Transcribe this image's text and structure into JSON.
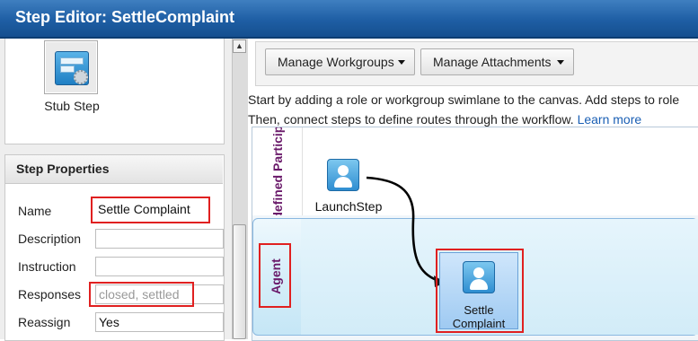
{
  "title": "Step Editor: SettleComplaint",
  "palette": {
    "stub_step_label": "Stub Step",
    "stub_icon": "stub-step-icon"
  },
  "properties": {
    "header": "Step Properties",
    "fields": {
      "name": {
        "label": "Name",
        "value": "Settle Complaint"
      },
      "description": {
        "label": "Description",
        "value": ""
      },
      "instruction": {
        "label": "Instruction",
        "value": ""
      },
      "responses": {
        "label": "Responses",
        "value": "",
        "placeholder": "closed, settled"
      },
      "reassign": {
        "label": "Reassign",
        "value": "Yes"
      }
    }
  },
  "toolbar": {
    "manage_workgroups": "Manage Workgroups",
    "manage_attachments": "Manage Attachments"
  },
  "intro": {
    "line1": "Start by adding a role or workgroup swimlane to the canvas. Add steps to role",
    "line2": "Then, connect steps to define routes through the workflow.",
    "learn_more": "Learn more"
  },
  "canvas": {
    "lanes": [
      {
        "label": "Undefined Participant"
      },
      {
        "label": "Agent"
      }
    ],
    "steps": [
      {
        "label": "LaunchStep"
      },
      {
        "label_line1": "Settle",
        "label_line2": "Complaint"
      }
    ]
  },
  "colors": {
    "title_bar": "#1e5ea4",
    "highlight": "#e02020",
    "lane_label": "#6a1a6a",
    "link": "#1a5fb4"
  }
}
